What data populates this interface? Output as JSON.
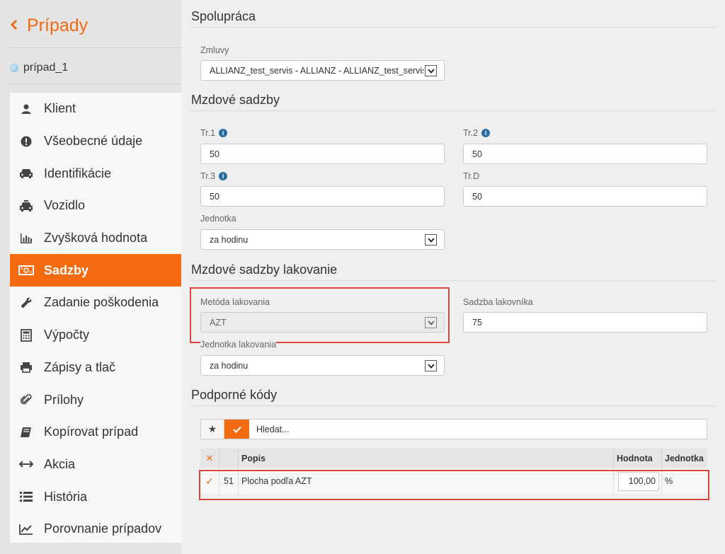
{
  "sidebar": {
    "back_label": "Prípady",
    "case_name": "prípad_1",
    "items": [
      {
        "label": "Klient",
        "icon": "user-icon",
        "active": false
      },
      {
        "label": "Všeobecné údaje",
        "icon": "exclamation-icon",
        "active": false
      },
      {
        "label": "Identifikácie",
        "icon": "car-icon",
        "active": false
      },
      {
        "label": "Vozidlo",
        "icon": "taxi-icon",
        "active": false
      },
      {
        "label": "Zvyšková hodnota",
        "icon": "bar-chart-icon",
        "active": false
      },
      {
        "label": "Sadzby",
        "icon": "money-icon",
        "active": true
      },
      {
        "label": "Zadanie poškodenia",
        "icon": "wrench-icon",
        "active": false
      },
      {
        "label": "Výpočty",
        "icon": "calculator-icon",
        "active": false
      },
      {
        "label": "Zápisy a tlač",
        "icon": "print-icon",
        "active": false
      },
      {
        "label": "Prílohy",
        "icon": "paperclip-icon",
        "active": false
      },
      {
        "label": "Kopírovat prípad",
        "icon": "book-icon",
        "active": false
      },
      {
        "label": "Akcia",
        "icon": "arrows-horizontal-icon",
        "active": false
      },
      {
        "label": "História",
        "icon": "list-icon",
        "active": false
      },
      {
        "label": "Porovnanie prípadov",
        "icon": "line-chart-icon",
        "active": false
      }
    ]
  },
  "cooperation": {
    "title": "Spolupráca",
    "contracts_label": "Zmluvy",
    "contracts_value": "ALLIANZ_test_servis - ALLIANZ - ALLIANZ_test_servis"
  },
  "wage_rates": {
    "title": "Mzdové sadzby",
    "tr1_label": "Tr.1",
    "tr1_value": "50",
    "tr2_label": "Tr.2",
    "tr2_value": "50",
    "tr3_label": "Tr.3",
    "tr3_value": "50",
    "trd_label": "Tr.D",
    "trd_value": "50",
    "unit_label": "Jednotka",
    "unit_value": "za hodinu"
  },
  "paint_rates": {
    "title": "Mzdové sadzby lakovanie",
    "method_label": "Metóda lakovania",
    "method_value": "AZT",
    "painter_rate_label": "Sadzba lakovníka",
    "painter_rate_value": "75",
    "unit_label": "Jednotka lakovania",
    "unit_value": "za hodinu"
  },
  "support_codes": {
    "title": "Podporné kódy",
    "search_placeholder": "Hledat...",
    "columns": {
      "remove": "✕",
      "code": "",
      "description": "Popis",
      "value": "Hodnota",
      "unit": "Jednotka"
    },
    "rows": [
      {
        "checked": "✓",
        "code": "51",
        "description": "Plocha podľa AZT",
        "value": "100,00",
        "unit": "%"
      }
    ]
  },
  "colors": {
    "accent": "#f46a0e",
    "highlight": "#d9453b",
    "info": "#2a6ea0"
  }
}
